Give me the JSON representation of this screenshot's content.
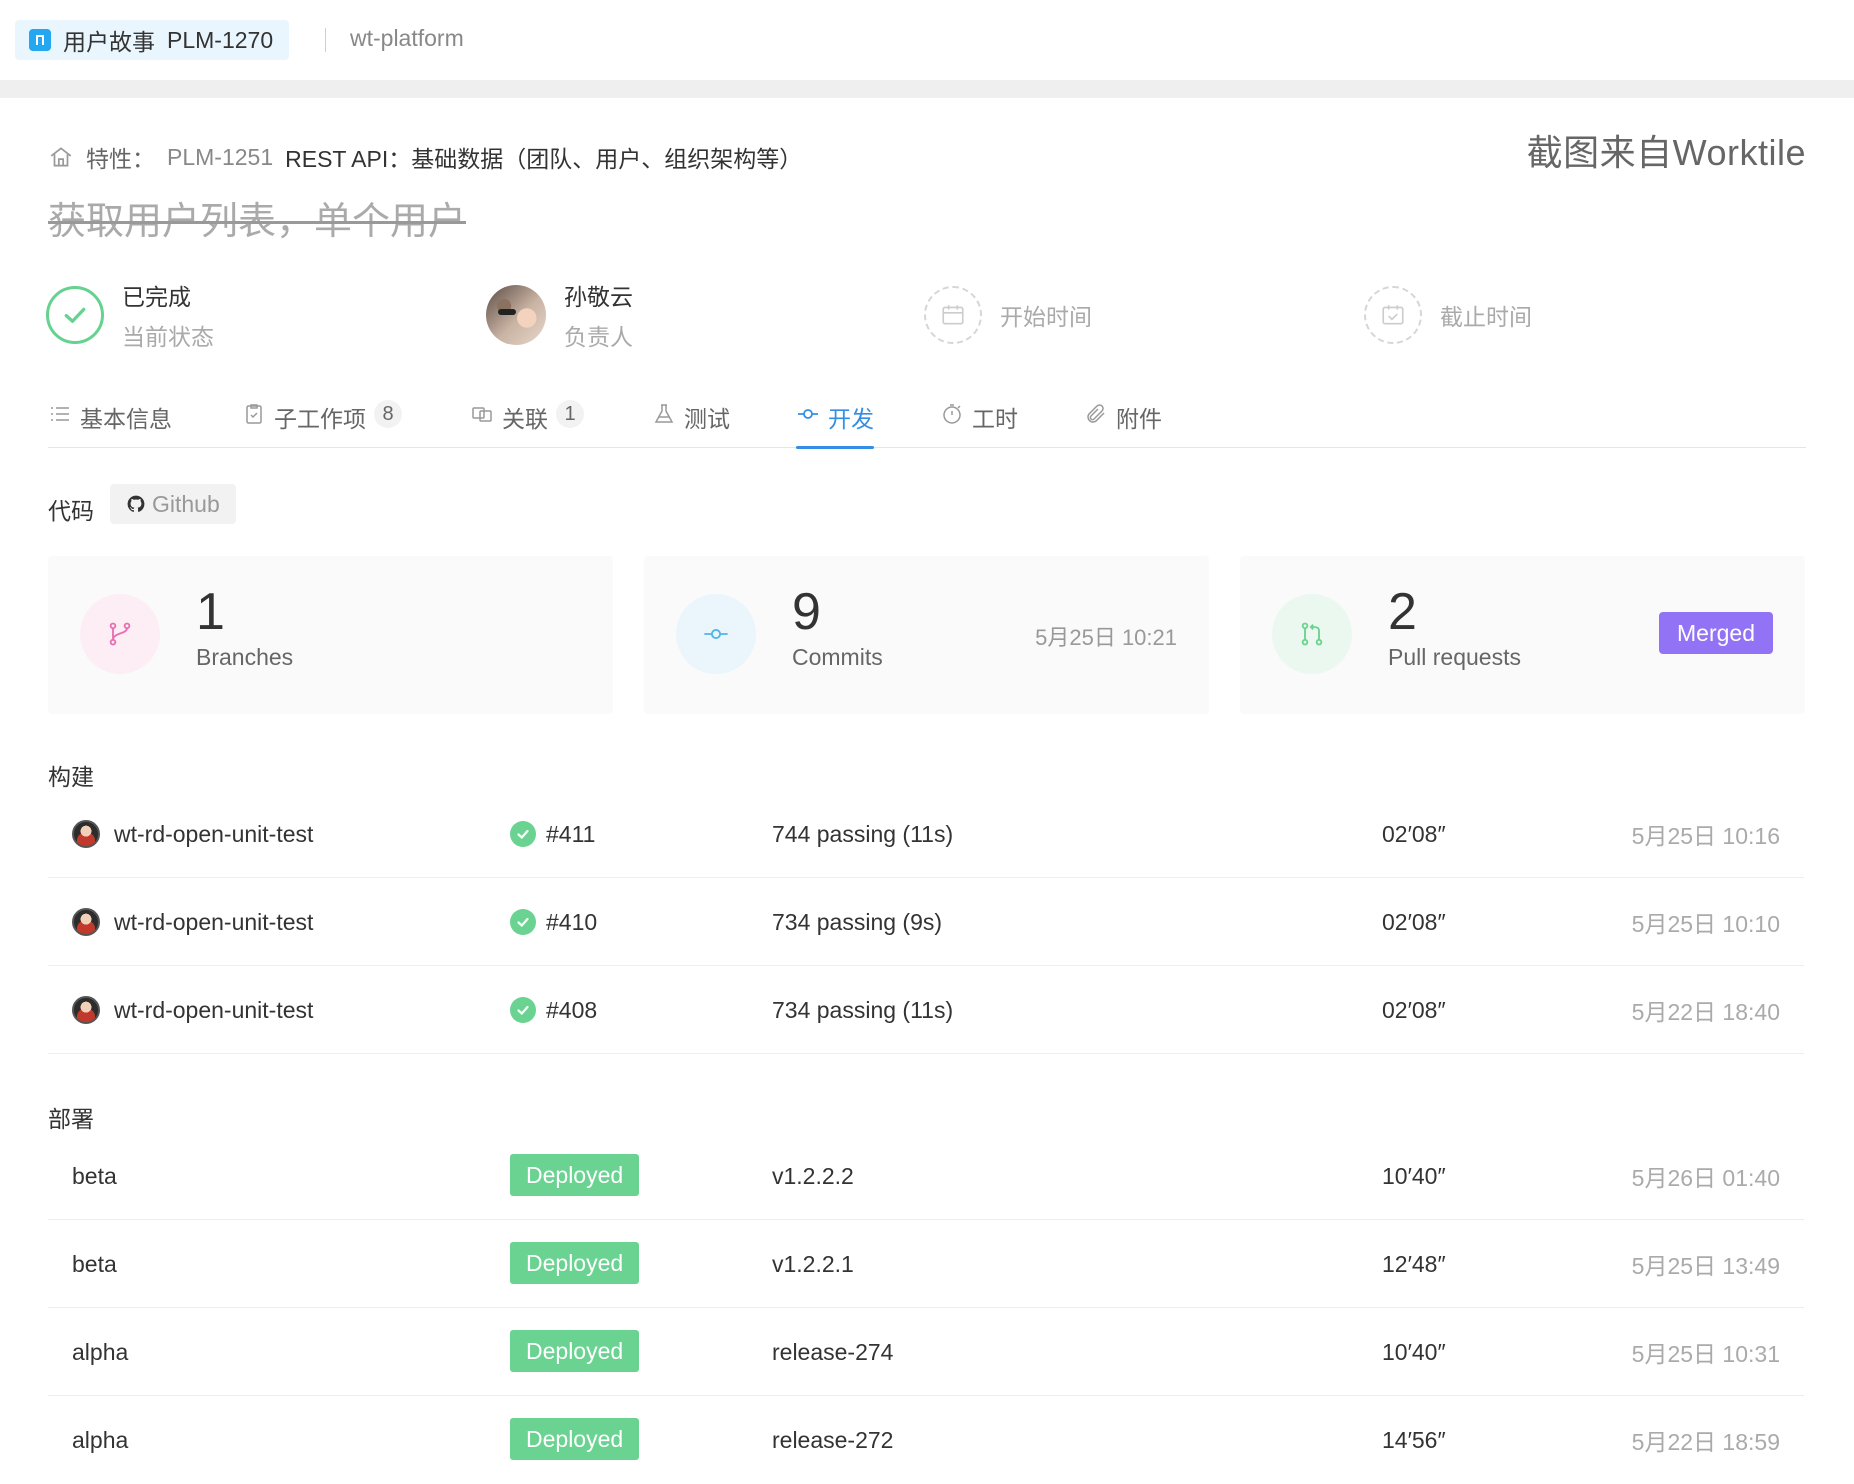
{
  "topbar": {
    "type_label": "用户故事",
    "item_id": "PLM-1270",
    "project": "wt-platform"
  },
  "watermark": "截图来自Worktile",
  "breadcrumb": {
    "prefix": "特性：",
    "parent_id": "PLM-1251",
    "parent_title": "REST API：基础数据（团队、用户、组织架构等）"
  },
  "title": "获取用户列表，单个用户",
  "meta": {
    "status_value": "已完成",
    "status_label": "当前状态",
    "owner_value": "孙敬云",
    "owner_label": "负责人",
    "start_placeholder": "开始时间",
    "due_placeholder": "截止时间"
  },
  "tabs": [
    {
      "label": "基本信息",
      "icon": "list-icon"
    },
    {
      "label": "子工作项",
      "count": "8",
      "icon": "clipboard-icon"
    },
    {
      "label": "关联",
      "count": "1",
      "icon": "link-icon"
    },
    {
      "label": "测试",
      "icon": "flask-icon"
    },
    {
      "label": "开发",
      "icon": "commit-icon",
      "active": true
    },
    {
      "label": "工时",
      "icon": "stopwatch-icon"
    },
    {
      "label": "附件",
      "icon": "paperclip-icon"
    }
  ],
  "code": {
    "section_title": "代码",
    "provider": "Github",
    "branches": {
      "count": "1",
      "label": "Branches"
    },
    "commits": {
      "count": "9",
      "label": "Commits",
      "date": "5月25日 10:21"
    },
    "pull_requests": {
      "count": "2",
      "label": "Pull requests",
      "status": "Merged"
    }
  },
  "builds": {
    "section_title": "构建",
    "rows": [
      {
        "name": "wt-rd-open-unit-test",
        "number": "#411",
        "result": "744 passing (11s)",
        "duration": "02′08″",
        "time": "5月25日 10:16"
      },
      {
        "name": "wt-rd-open-unit-test",
        "number": "#410",
        "result": "734 passing (9s)",
        "duration": "02′08″",
        "time": "5月25日 10:10"
      },
      {
        "name": "wt-rd-open-unit-test",
        "number": "#408",
        "result": "734 passing (11s)",
        "duration": "02′08″",
        "time": "5月22日 18:40"
      }
    ]
  },
  "deploys": {
    "section_title": "部署",
    "rows": [
      {
        "env": "beta",
        "status": "Deployed",
        "version": "v1.2.2.2",
        "duration": "10′40″",
        "time": "5月26日 01:40"
      },
      {
        "env": "beta",
        "status": "Deployed",
        "version": "v1.2.2.1",
        "duration": "12′48″",
        "time": "5月25日 13:49"
      },
      {
        "env": "alpha",
        "status": "Deployed",
        "version": "release-274",
        "duration": "10′40″",
        "time": "5月25日 10:31"
      },
      {
        "env": "alpha",
        "status": "Deployed",
        "version": "release-272",
        "duration": "14′56″",
        "time": "5月22日 18:59"
      }
    ]
  },
  "colors": {
    "accent": "#348fe4",
    "success": "#6bd391",
    "merged": "#9373f5",
    "branch": "#e96fb0",
    "commit": "#4fb5e8",
    "pr": "#6bd391"
  }
}
